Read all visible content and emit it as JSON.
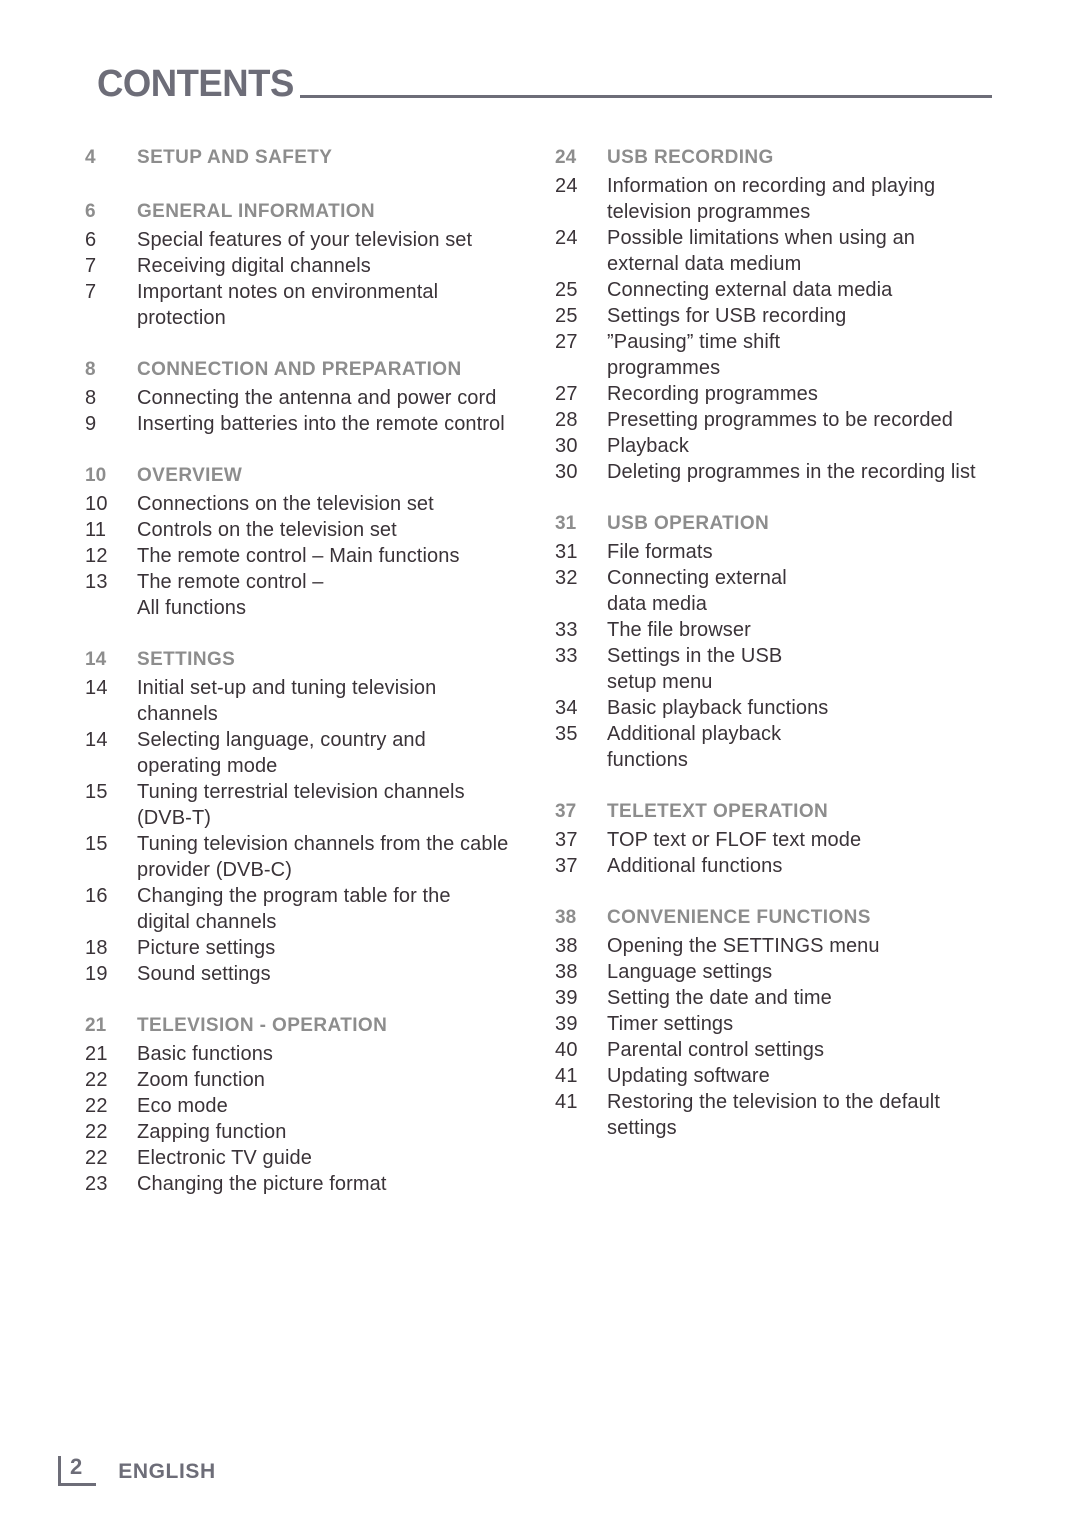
{
  "header": {
    "title": "CONTENTS"
  },
  "footer": {
    "page_number": "2",
    "language": "ENGLISH"
  },
  "toc": {
    "left_column": [
      {
        "type": "section",
        "page": "4",
        "text": "SETUP AND SAFETY"
      },
      {
        "type": "section",
        "page": "6",
        "text": "GENERAL INFORMATION"
      },
      {
        "type": "entry",
        "page": "6",
        "text": "Special features of your television set"
      },
      {
        "type": "entry",
        "page": "7",
        "text": "Receiving digital channels"
      },
      {
        "type": "entry",
        "page": "7",
        "text": "Important notes on environmental"
      },
      {
        "type": "cont",
        "page": "",
        "text": "protection"
      },
      {
        "type": "section",
        "page": "8",
        "text": "CONNECTION AND PREPARATION"
      },
      {
        "type": "entry",
        "page": "8",
        "text": "Connecting the antenna and power cord"
      },
      {
        "type": "entry",
        "page": "9",
        "text": "Inserting batteries into the remote control"
      },
      {
        "type": "section",
        "page": "10",
        "text": "OVERVIEW"
      },
      {
        "type": "entry",
        "page": "10",
        "text": "Connections on the television set"
      },
      {
        "type": "entry",
        "page": "11",
        "text": "Controls on the television set"
      },
      {
        "type": "entry",
        "page": "12",
        "text": "The remote control – Main functions"
      },
      {
        "type": "entry",
        "page": "13",
        "text": "The remote control –"
      },
      {
        "type": "cont",
        "page": "",
        "text": "All functions"
      },
      {
        "type": "section",
        "page": "14",
        "text": "SETTINGS"
      },
      {
        "type": "entry",
        "page": "14",
        "text": "Initial set-up and tuning television"
      },
      {
        "type": "cont",
        "page": "",
        "text": "channels"
      },
      {
        "type": "entry",
        "page": "14",
        "text": "Selecting language, country and"
      },
      {
        "type": "cont",
        "page": "",
        "text": "operating mode"
      },
      {
        "type": "entry",
        "page": "15",
        "text": "Tuning terrestrial television channels"
      },
      {
        "type": "cont",
        "page": "",
        "text": "(DVB-T)"
      },
      {
        "type": "entry",
        "page": "15",
        "text": "Tuning television channels from the cable"
      },
      {
        "type": "cont",
        "page": "",
        "text": "provider (DVB-C)"
      },
      {
        "type": "entry",
        "page": "16",
        "text": "Changing the program table for the"
      },
      {
        "type": "cont",
        "page": "",
        "text": "digital channels"
      },
      {
        "type": "entry",
        "page": "18",
        "text": "Picture settings"
      },
      {
        "type": "entry",
        "page": "19",
        "text": "Sound settings"
      },
      {
        "type": "section",
        "page": "21",
        "text": "TELEVISION - OPERATION"
      },
      {
        "type": "entry",
        "page": "21",
        "text": "Basic functions"
      },
      {
        "type": "entry",
        "page": "22",
        "text": "Zoom function"
      },
      {
        "type": "entry",
        "page": "22",
        "text": "Eco mode"
      },
      {
        "type": "entry",
        "page": "22",
        "text": "Zapping function"
      },
      {
        "type": "entry",
        "page": "22",
        "text": "Electronic TV guide"
      },
      {
        "type": "entry",
        "page": "23",
        "text": "Changing the picture format"
      }
    ],
    "right_column": [
      {
        "type": "section",
        "page": "24",
        "text": "USB RECORDING"
      },
      {
        "type": "entry",
        "page": "24",
        "text": "Information on recording and playing"
      },
      {
        "type": "cont",
        "page": "",
        "text": "television programmes"
      },
      {
        "type": "entry",
        "page": "24",
        "text": "Possible limitations when using an"
      },
      {
        "type": "cont",
        "page": "",
        "text": "external data medium"
      },
      {
        "type": "entry",
        "page": "25",
        "text": "Connecting external data media"
      },
      {
        "type": "entry",
        "page": "25",
        "text": "Settings for USB recording"
      },
      {
        "type": "entry",
        "page": "27",
        "text": "”Pausing” time shift"
      },
      {
        "type": "cont",
        "page": "",
        "text": "programmes"
      },
      {
        "type": "entry",
        "page": "27",
        "text": "Recording programmes"
      },
      {
        "type": "entry",
        "page": "28",
        "text": "Presetting programmes to be recorded"
      },
      {
        "type": "entry",
        "page": "30",
        "text": "Playback"
      },
      {
        "type": "entry",
        "page": "30",
        "text": "Deleting programmes in the recording list"
      },
      {
        "type": "section",
        "page": "31",
        "text": "USB OPERATION"
      },
      {
        "type": "entry",
        "page": "31",
        "text": "File formats"
      },
      {
        "type": "entry",
        "page": "32",
        "text": "Connecting external"
      },
      {
        "type": "cont",
        "page": "",
        "text": "data media"
      },
      {
        "type": "entry",
        "page": "33",
        "text": "The file browser"
      },
      {
        "type": "entry",
        "page": "33",
        "text": "Settings in the USB"
      },
      {
        "type": "cont",
        "page": "",
        "text": "setup menu"
      },
      {
        "type": "entry",
        "page": "34",
        "text": "Basic playback functions"
      },
      {
        "type": "entry",
        "page": "35",
        "text": "Additional playback"
      },
      {
        "type": "cont",
        "page": "",
        "text": "functions"
      },
      {
        "type": "section",
        "page": "37",
        "text": "TELETEXT OPERATION"
      },
      {
        "type": "entry",
        "page": "37",
        "text": "TOP text or FLOF text mode"
      },
      {
        "type": "entry",
        "page": "37",
        "text": "Additional functions"
      },
      {
        "type": "section",
        "page": "38",
        "text": "CONVENIENCE FUNCTIONS"
      },
      {
        "type": "entry",
        "page": "38",
        "text": "Opening the SETTINGS menu"
      },
      {
        "type": "entry",
        "page": "38",
        "text": "Language settings"
      },
      {
        "type": "entry",
        "page": "39",
        "text": "Setting the date and time"
      },
      {
        "type": "entry",
        "page": "39",
        "text": "Timer settings"
      },
      {
        "type": "entry",
        "page": "40",
        "text": "Parental control settings"
      },
      {
        "type": "entry",
        "page": "41",
        "text": "Updating software"
      },
      {
        "type": "entry",
        "page": "41",
        "text": "Restoring the television to the default"
      },
      {
        "type": "cont",
        "page": "",
        "text": "settings"
      }
    ]
  },
  "colors": {
    "title": "#6d6d78",
    "section_heading": "#8d8d8d",
    "body_text": "#3a3338",
    "rule": "#6d6d78",
    "background": "#ffffff"
  }
}
